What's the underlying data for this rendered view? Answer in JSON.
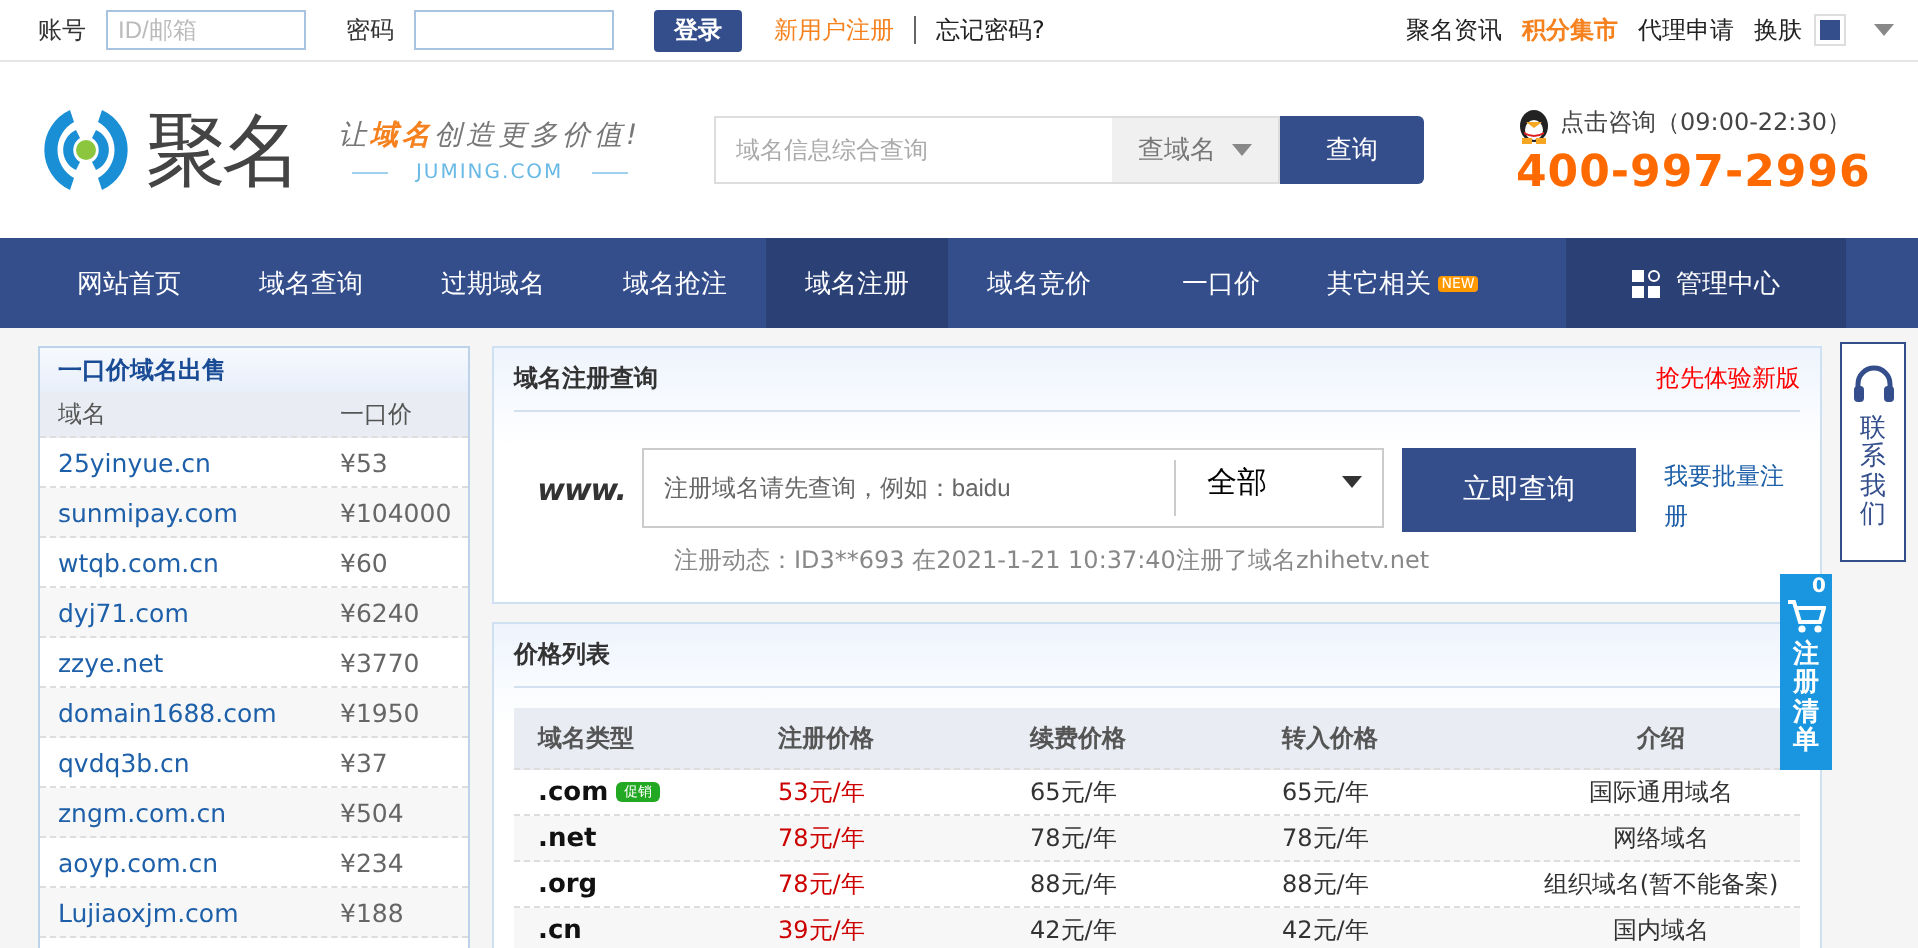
{
  "topbar": {
    "account_label": "账号",
    "account_placeholder": "ID/邮箱",
    "password_label": "密码",
    "login": "登录",
    "register": "新用户注册",
    "forgot": "忘记密码?",
    "links": [
      {
        "label": "聚名资讯",
        "highlight": false
      },
      {
        "label": "积分集市",
        "highlight": true
      },
      {
        "label": "代理申请",
        "highlight": false
      }
    ],
    "skin_label": "换肤"
  },
  "header": {
    "logo": "聚名",
    "slogan": "让**域名**创造更多价值!",
    "domain": "JUMING.COM",
    "search_placeholder": "域名信息综合查询",
    "search_type": "查域名",
    "search_button": "查询",
    "consult": "点击咨询（09:00-22:30）",
    "phone": "400-997-2996"
  },
  "nav": [
    {
      "label": "网站首页",
      "selected": false
    },
    {
      "label": "域名查询",
      "selected": false
    },
    {
      "label": "过期域名",
      "selected": false
    },
    {
      "label": "域名抢注",
      "selected": false
    },
    {
      "label": "域名注册",
      "selected": true
    },
    {
      "label": "域名竞价",
      "selected": false
    },
    {
      "label": "一口价",
      "selected": false
    },
    {
      "label": "其它相关",
      "selected": false,
      "badge": "NEW"
    }
  ],
  "admin": "管理中心",
  "sale": {
    "title": "一口价域名出售",
    "columns": [
      "域名",
      "一口价"
    ],
    "rows": [
      {
        "domain": "25yinyue.cn",
        "price": "¥53"
      },
      {
        "domain": "sunmipay.com",
        "price": "¥104000"
      },
      {
        "domain": "wtqb.com.cn",
        "price": "¥60"
      },
      {
        "domain": "dyj71.com",
        "price": "¥6240"
      },
      {
        "domain": "zzye.net",
        "price": "¥3770"
      },
      {
        "domain": "domain1688.com",
        "price": "¥1950"
      },
      {
        "domain": "qvdq3b.cn",
        "price": "¥37"
      },
      {
        "domain": "zngm.com.cn",
        "price": "¥504"
      },
      {
        "domain": "aoyp.com.cn",
        "price": "¥234"
      },
      {
        "domain": "Lujiaoxjm.com",
        "price": "¥188"
      }
    ]
  },
  "query": {
    "title": "域名注册查询",
    "new_version": "抢先体验新版",
    "prefix": "www.",
    "placeholder": "注册域名请先查询，例如：baidu",
    "suffix": "全部",
    "button": "立即查询",
    "bulk": "我要批量注册",
    "activity": "注册动态：ID3**693 在2021-1-21 10:37:40注册了域名zhihetv.net"
  },
  "prices": {
    "title": "价格列表",
    "columns": [
      "域名类型",
      "注册价格",
      "续费价格",
      "转入价格",
      "介绍"
    ],
    "rows": [
      {
        "type": ".com",
        "badge": "促销",
        "register": "53元/年",
        "renew": "65元/年",
        "transfer": "65元/年",
        "intro": "国际通用域名"
      },
      {
        "type": ".net",
        "register": "78元/年",
        "renew": "78元/年",
        "transfer": "78元/年",
        "intro": "网络域名"
      },
      {
        "type": ".org",
        "register": "78元/年",
        "renew": "88元/年",
        "transfer": "88元/年",
        "intro": "组织域名(暂不能备案)"
      },
      {
        "type": ".cn",
        "register": "39元/年",
        "renew": "42元/年",
        "transfer": "42元/年",
        "intro": "国内域名"
      }
    ]
  },
  "contact": "联系我们",
  "cart": {
    "count": "0",
    "label": "注册清单"
  }
}
